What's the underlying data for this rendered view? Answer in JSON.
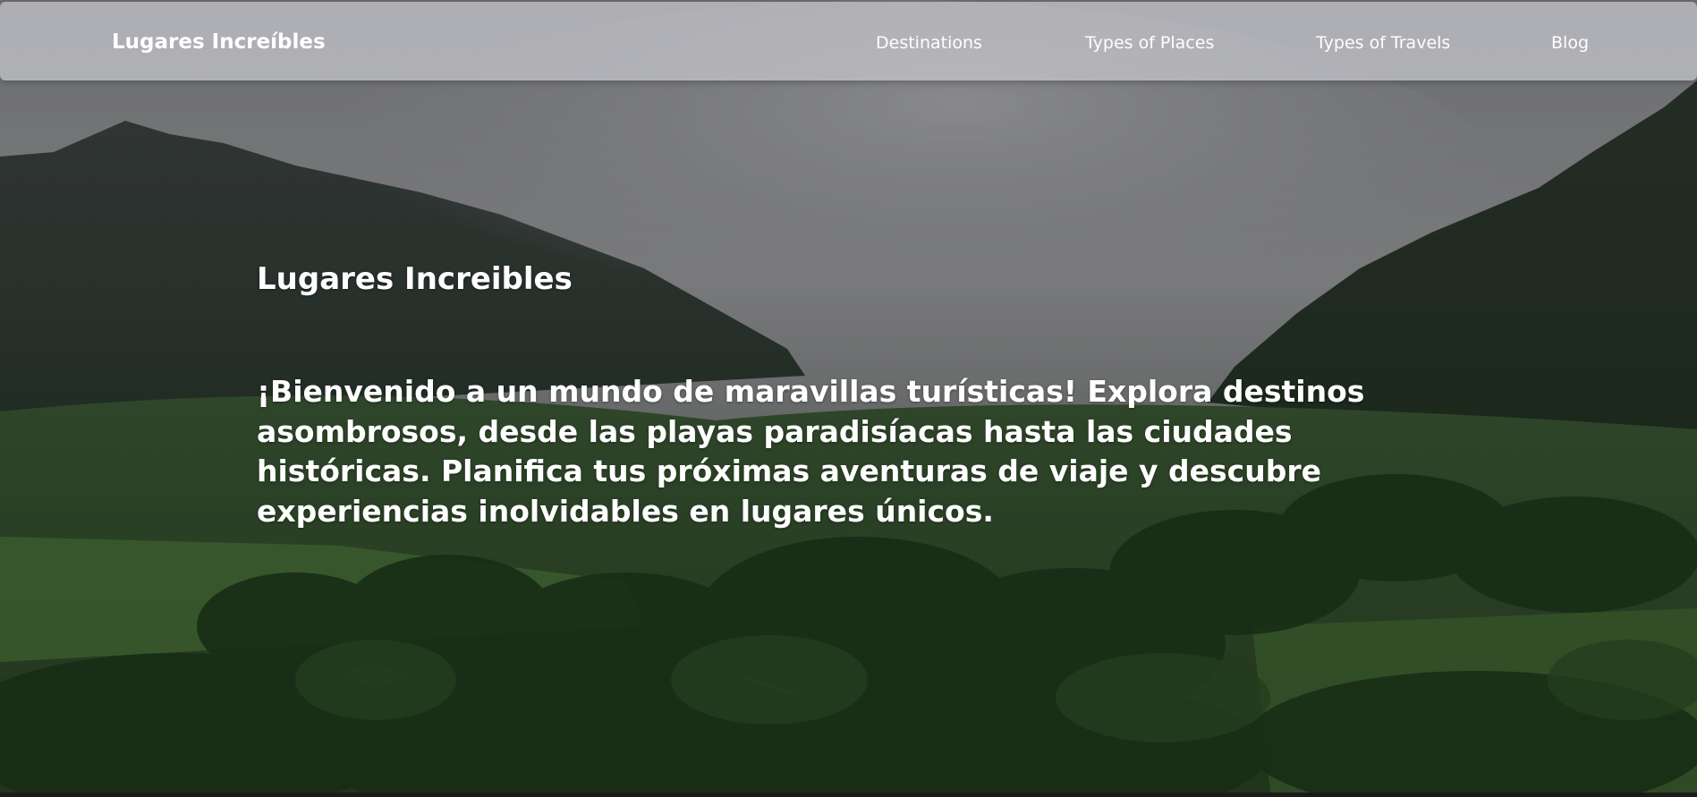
{
  "navbar": {
    "brand": "Lugares Increíbles",
    "links": [
      {
        "label": "Destinations"
      },
      {
        "label": "Types of Places"
      },
      {
        "label": "Types of Travels"
      },
      {
        "label": "Blog"
      }
    ]
  },
  "hero": {
    "title": "Lugares Increibles",
    "text": "¡Bienvenido a un mundo de maravillas turísticas! Explora destinos asombrosos, desde las playas paradisíacas hasta las ciudades históricas. Planifica tus próximas aventuras de viaje y descubre experiencias inolvidables en lugares únicos.",
    "background": "foggy-mountains-jungle-valley"
  },
  "colors": {
    "nav_text": "#ffffff",
    "hero_text": "#ffffff",
    "navbar_bg": "#c8c8cd"
  }
}
